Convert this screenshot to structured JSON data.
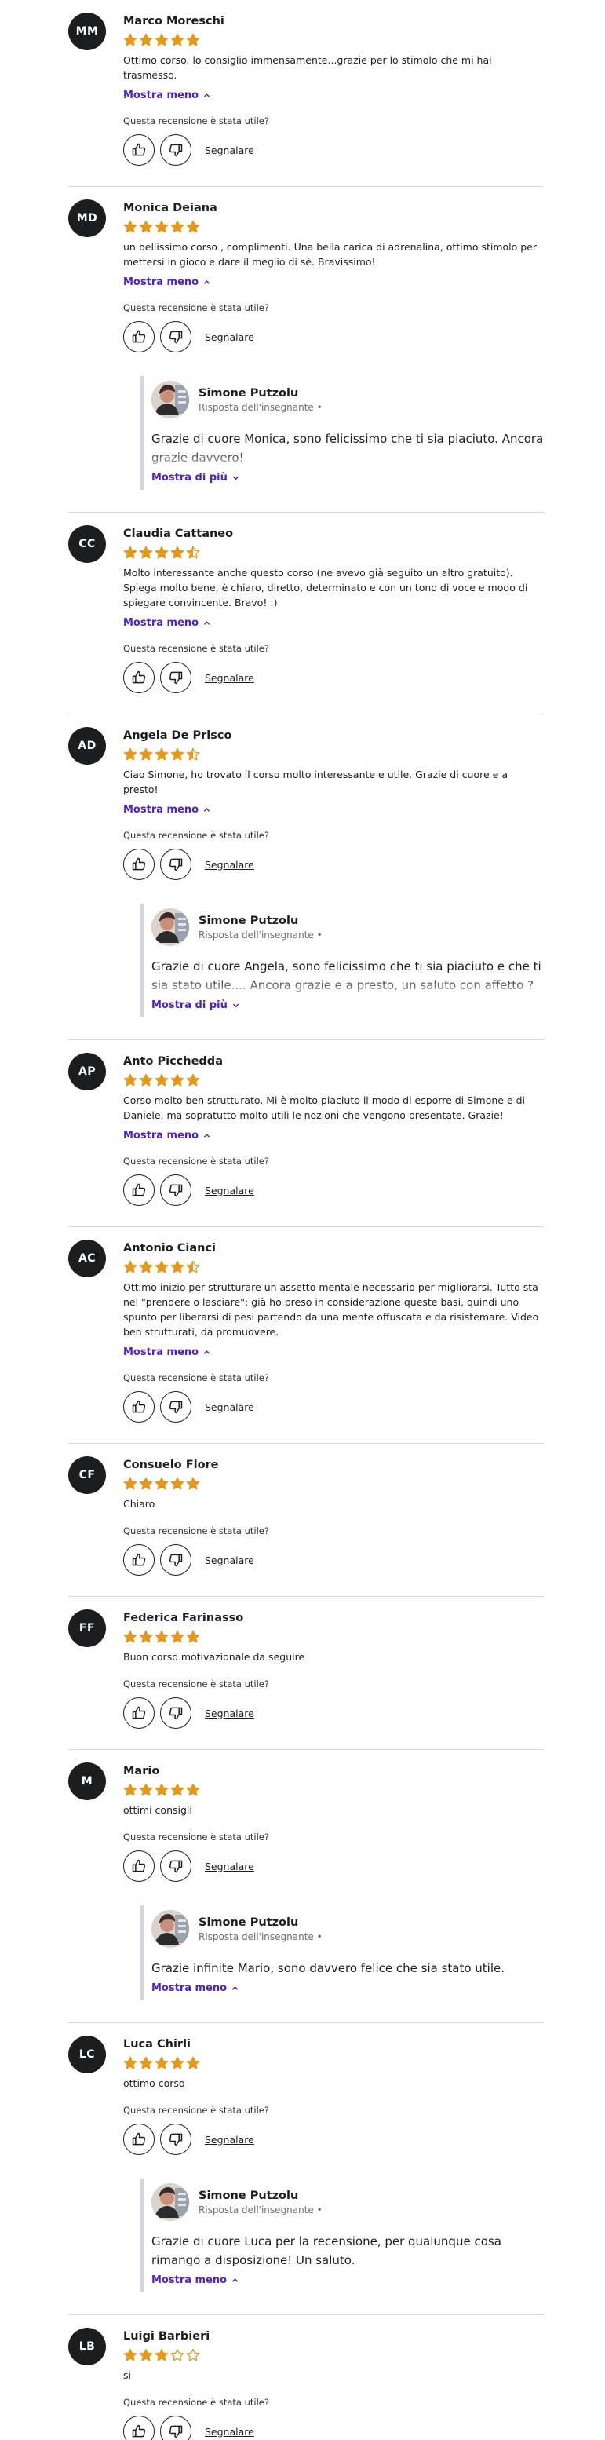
{
  "labels": {
    "show_less": "Mostra meno",
    "show_more": "Mostra di più",
    "helpful_question": "Questa recensione è stata utile?",
    "report": "Segnalare",
    "instructor_role": "Risposta dell'insegnante •"
  },
  "colors": {
    "star": "#e59819",
    "accent": "#5022c3",
    "avatar_bg": "#1c1d1f"
  },
  "icons": {
    "like": "thumbs-up-icon",
    "dislike": "thumbs-down-icon",
    "star": "star-icon"
  },
  "reviews": [
    {
      "initials": "MM",
      "name": "Marco Moreschi",
      "rating": 5,
      "text": "Ottimo corso. lo consiglio immensamente...grazie per lo stimolo che mi hai trasmesso.",
      "has_toggle": true
    },
    {
      "initials": "MD",
      "name": "Monica Deiana",
      "rating": 5,
      "text": "un bellissimo corso , complimenti. Una bella carica di adrenalina, ottimo stimolo per mettersi in gioco e dare il meglio di sè. Bravissimo!",
      "has_toggle": true,
      "response": {
        "name": "Simone Putzolu",
        "text": "Grazie di cuore Monica, sono felicissimo che ti sia piaciuto. Ancora grazie davvero!",
        "expanded": false
      }
    },
    {
      "initials": "CC",
      "name": "Claudia Cattaneo",
      "rating": 4.5,
      "text": "Molto interessante anche questo corso (ne avevo già seguito un altro gratuito). Spiega molto bene, è chiaro, diretto, determinato e con un tono di voce e modo di spiegare convincente. Bravo! :)",
      "has_toggle": true
    },
    {
      "initials": "AD",
      "name": "Angela De Prisco",
      "rating": 4.5,
      "text": "Ciao Simone, ho trovato il corso molto interessante e utile. Grazie di cuore e a presto!",
      "has_toggle": true,
      "response": {
        "name": "Simone Putzolu",
        "text": "Grazie di cuore Angela, sono felicissimo che ti sia piaciuto e che ti sia stato utile.... Ancora grazie e a presto, un saluto con affetto ?",
        "expanded": false
      }
    },
    {
      "initials": "AP",
      "name": "Anto Picchedda",
      "rating": 5,
      "text": "Corso molto ben strutturato. Mi è molto piaciuto il modo di esporre di Simone e di Daniele, ma sopratutto molto utili le nozioni che vengono presentate. Grazie!",
      "has_toggle": true
    },
    {
      "initials": "AC",
      "name": "Antonio Cianci",
      "rating": 4.5,
      "text": "Ottimo inizio per strutturare un assetto mentale necessario per migliorarsi. Tutto sta nel \"prendere o lasciare\": già ho preso in considerazione queste basi, quindi uno spunto per liberarsi di pesi partendo da una mente offuscata e da risistemare. Video ben strutturati, da promuovere.",
      "has_toggle": true
    },
    {
      "initials": "CF",
      "name": "Consuelo Flore",
      "rating": 5,
      "text": "Chiaro",
      "has_toggle": false
    },
    {
      "initials": "FF",
      "name": "Federica Farinasso",
      "rating": 5,
      "text": "Buon corso motivazionale da seguire",
      "has_toggle": false
    },
    {
      "initials": "M",
      "name": "Mario",
      "rating": 5,
      "text": "ottimi consigli",
      "has_toggle": false,
      "response": {
        "name": "Simone Putzolu",
        "text": "Grazie infinite Mario, sono davvero felice che sia stato utile.",
        "expanded": true
      }
    },
    {
      "initials": "LC",
      "name": "Luca Chirli",
      "rating": 5,
      "text": "ottimo corso",
      "has_toggle": false,
      "response": {
        "name": "Simone Putzolu",
        "text": "Grazie di cuore Luca per la recensione, per qualunque cosa rimango a disposizione! Un saluto.",
        "expanded": true
      }
    },
    {
      "initials": "LB",
      "name": "Luigi Barbieri",
      "rating": 3,
      "text": "si",
      "has_toggle": false
    }
  ]
}
